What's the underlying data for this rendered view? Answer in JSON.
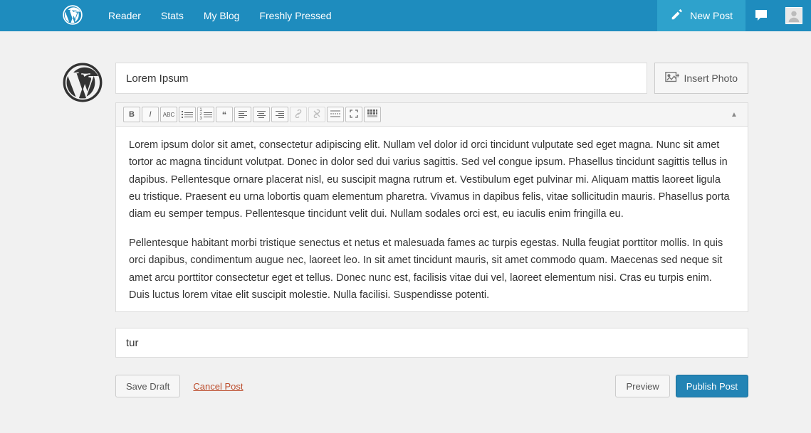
{
  "topbar": {
    "nav": [
      "Reader",
      "Stats",
      "My Blog",
      "Freshly Pressed"
    ],
    "new_post_label": "New Post"
  },
  "editor": {
    "title_value": "Lorem Ipsum",
    "insert_photo_label": "Insert Photo",
    "toolbar_buttons": [
      "bold",
      "italic",
      "strikethrough",
      "bulleted-list",
      "numbered-list",
      "blockquote",
      "align-left",
      "align-center",
      "align-right",
      "link",
      "unlink",
      "more-tag",
      "fullscreen",
      "kitchen-sink"
    ],
    "content_paragraphs": [
      "Lorem ipsum dolor sit amet, consectetur adipiscing elit. Nullam vel dolor id orci tincidunt vulputate sed eget magna. Nunc sit amet tortor ac magna tincidunt volutpat. Donec in dolor sed dui varius sagittis. Sed vel congue ipsum. Phasellus tincidunt sagittis tellus in dapibus. Pellentesque ornare placerat nisl, eu suscipit magna rutrum et. Vestibulum eget pulvinar mi. Aliquam mattis laoreet ligula eu tristique. Praesent eu urna lobortis quam elementum pharetra. Vivamus in dapibus felis, vitae sollicitudin mauris. Phasellus porta diam eu semper tempus. Pellentesque tincidunt velit dui. Nullam sodales orci est, eu iaculis enim fringilla eu.",
      "Pellentesque habitant morbi tristique senectus et netus et malesuada fames ac turpis egestas. Nulla feugiat porttitor mollis. In quis orci dapibus, condimentum augue nec, laoreet leo. In sit amet tincidunt mauris, sit amet commodo quam. Maecenas sed neque sit amet arcu porttitor consectetur eget et tellus. Donec nunc est, facilisis vitae dui vel, laoreet elementum nisi. Cras eu turpis enim. Duis luctus lorem vitae elit suscipit molestie. Nulla facilisi. Suspendisse potenti."
    ],
    "tags_value": "tur"
  },
  "actions": {
    "save_draft": "Save Draft",
    "cancel_post": "Cancel Post",
    "preview": "Preview",
    "publish": "Publish Post"
  }
}
